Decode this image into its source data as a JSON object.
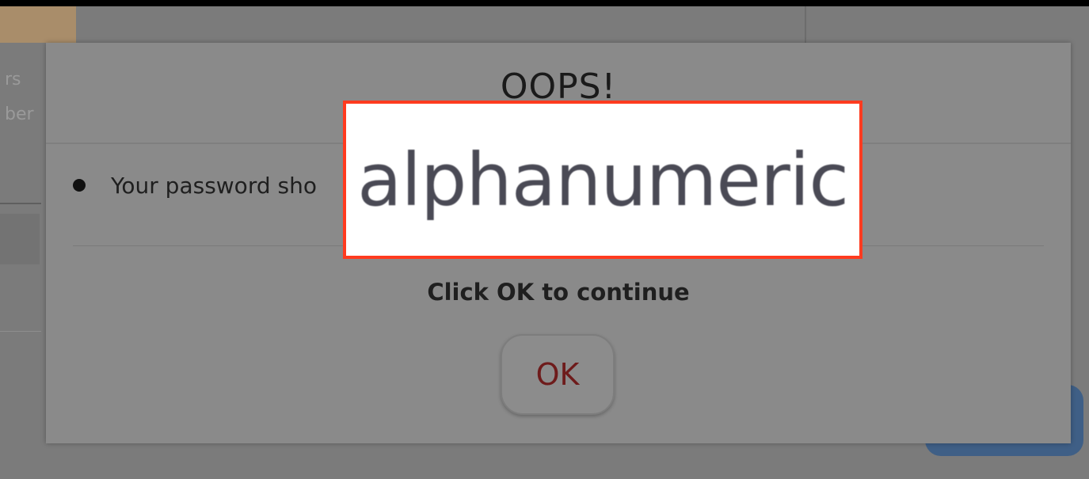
{
  "background_page": {
    "partial_text_line1": "rs",
    "partial_text_line2": "ber"
  },
  "modal": {
    "title": "OOPS!",
    "message_bullet": "Your password sho",
    "continue_prompt": "Click OK to continue",
    "ok_label": "OK"
  },
  "zoom_callout": {
    "text": "alphanumeric",
    "border_color": "#ff3b1f"
  },
  "colors": {
    "overlay": "#7b7b7b",
    "ok_text": "#6e1b1b"
  }
}
